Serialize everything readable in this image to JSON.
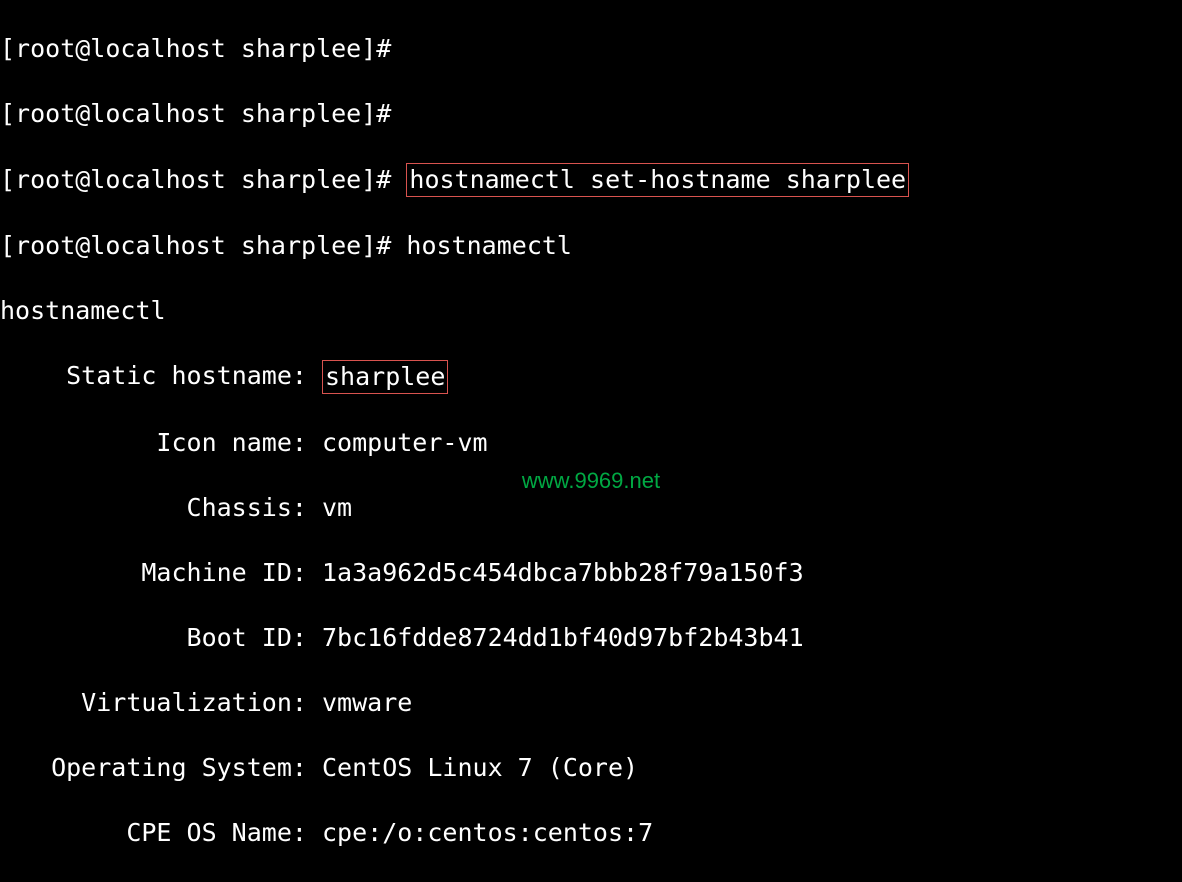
{
  "prompt": "[root@localhost sharplee]#",
  "cmd1": "hostnamectl set-hostname sharplee",
  "cmd2": "hostnamectl",
  "echo_line": "hostnamectl",
  "output": {
    "static_hostname": {
      "label": "Static hostname: ",
      "value": "sharplee"
    },
    "icon_name": {
      "label": "Icon name: ",
      "value": "computer-vm"
    },
    "chassis": {
      "label": "Chassis: ",
      "value": "vm"
    },
    "machine_id": {
      "label": "Machine ID: ",
      "value": "1a3a962d5c454dbca7bbb28f79a150f3"
    },
    "boot_id": {
      "label": "Boot ID: ",
      "value": "7bc16fdde8724dd1bf40d97bf2b43b41"
    },
    "virtualization": {
      "label": "Virtualization: ",
      "value": "vmware"
    },
    "operating_system": {
      "label": "Operating System: ",
      "value": "CentOS Linux 7 (Core)"
    },
    "cpe_os_name": {
      "label": "CPE OS Name: ",
      "value": "cpe:/o:centos:centos:7"
    }
  },
  "watermark": "www.9969.net"
}
